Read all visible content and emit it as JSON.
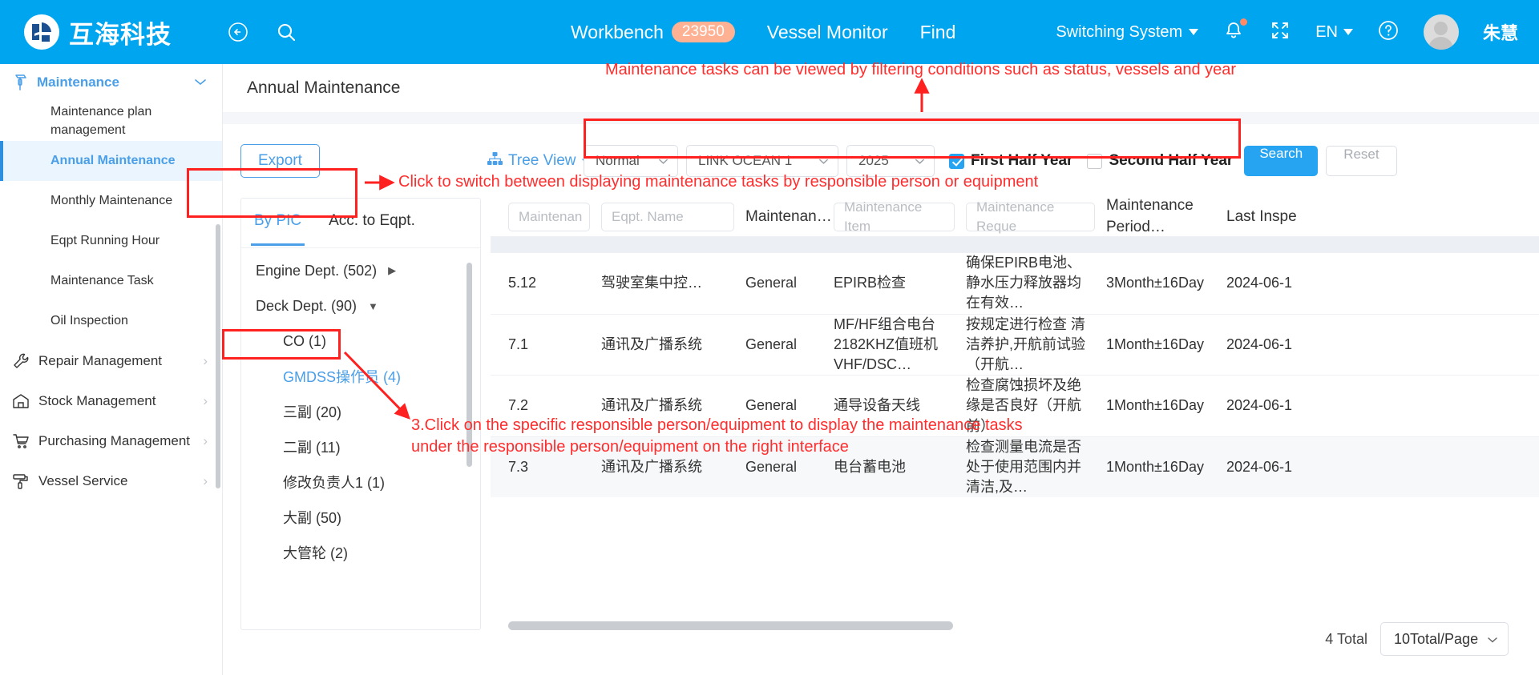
{
  "header": {
    "brand": "互海科技",
    "back_icon": "back-arrow-icon",
    "search_icon": "search-icon",
    "nav": [
      {
        "label": "Workbench",
        "badge": "23950"
      },
      {
        "label": "Vessel Monitor",
        "badge": ""
      },
      {
        "label": "Find",
        "badge": ""
      }
    ],
    "switching_system": "Switching System",
    "language": "EN",
    "username": "朱慧",
    "bell_icon": "bell-icon",
    "fullscreen_icon": "fullscreen-icon",
    "help_icon": "help-circle-icon",
    "accent": "#00a5f0"
  },
  "sidebar": {
    "group": {
      "label": "Maintenance",
      "icon": "hammer-icon"
    },
    "sub_items": [
      {
        "label": "Maintenance plan management",
        "active": false
      },
      {
        "label": "Annual Maintenance",
        "active": true
      },
      {
        "label": "Monthly Maintenance",
        "active": false
      },
      {
        "label": "Eqpt Running Hour",
        "active": false
      },
      {
        "label": "Maintenance Task",
        "active": false
      },
      {
        "label": "Oil Inspection",
        "active": false
      }
    ],
    "items": [
      {
        "label": "Repair Management",
        "icon": "wrench-icon"
      },
      {
        "label": "Stock Management",
        "icon": "warehouse-icon"
      },
      {
        "label": "Purchasing Management",
        "icon": "cart-icon"
      },
      {
        "label": "Vessel Service",
        "icon": "paint-roller-icon"
      }
    ]
  },
  "page": {
    "title": "Annual Maintenance"
  },
  "toolbar": {
    "export_label": "Export",
    "tree_view_label": "Tree View",
    "status_filter": "Normal",
    "vessel_filter": "LINK OCEAN 1",
    "year_filter": "2025",
    "first_half_label": "First Half Year",
    "first_half_checked": true,
    "second_half_label": "Second Half Year",
    "second_half_checked": false,
    "search_label": "Search",
    "reset_label": "Reset"
  },
  "tree": {
    "tabs": [
      {
        "label": "By PIC",
        "active": true
      },
      {
        "label": "Acc. to Eqpt.",
        "active": false
      }
    ],
    "nodes": [
      {
        "label": "Engine Dept. (502)",
        "level": 0,
        "arrow": "▶",
        "selected": false
      },
      {
        "label": "Deck Dept. (90)",
        "level": 0,
        "arrow": "▼",
        "selected": false
      },
      {
        "label": "CO (1)",
        "level": 1,
        "arrow": "",
        "selected": false
      },
      {
        "label": "GMDSS操作员 (4)",
        "level": 1,
        "arrow": "",
        "selected": true
      },
      {
        "label": "三副 (20)",
        "level": 1,
        "arrow": "",
        "selected": false
      },
      {
        "label": "二副 (11)",
        "level": 1,
        "arrow": "",
        "selected": false
      },
      {
        "label": "修改负责人1 (1)",
        "level": 1,
        "arrow": "",
        "selected": false
      },
      {
        "label": "大副 (50)",
        "level": 1,
        "arrow": "",
        "selected": false
      },
      {
        "label": "大管轮 (2)",
        "level": 1,
        "arrow": "",
        "selected": false
      }
    ]
  },
  "table": {
    "headers": [
      {
        "label": "Maintenan",
        "type": "input"
      },
      {
        "label": "Eqpt. Name",
        "type": "input"
      },
      {
        "label": "Maintenan…",
        "type": "plain"
      },
      {
        "label": "Maintenance Item",
        "type": "input"
      },
      {
        "label": "Maintenance Reque",
        "type": "input"
      },
      {
        "label": "Maintenance Period…",
        "type": "plain"
      },
      {
        "label": "Last Inspe",
        "type": "plain"
      }
    ],
    "rows": [
      {
        "no": "5.12",
        "eqpt": "驾驶室集中控…",
        "type": "General",
        "item": "EPIRB检查",
        "request": "确保EPIRB电池、静水压力释放器均在有效…",
        "period": "3Month±16Day",
        "last": "2024-06-1"
      },
      {
        "no": "7.1",
        "eqpt": "通讯及广播系统",
        "type": "General",
        "item": "MF/HF组合电台 2182KHZ值班机 VHF/DSC…",
        "request": "按规定进行检查 清洁养护,开航前试验（开航…",
        "period": "1Month±16Day",
        "last": "2024-06-1"
      },
      {
        "no": "7.2",
        "eqpt": "通讯及广播系统",
        "type": "General",
        "item": "通导设备天线",
        "request": "检查腐蚀损坏及绝缘是否良好（开航前）",
        "period": "1Month±16Day",
        "last": "2024-06-1"
      },
      {
        "no": "7.3",
        "eqpt": "通讯及广播系统",
        "type": "General",
        "item": "电台蓄电池",
        "request": "检查测量电流是否处于使用范围内并清洁,及…",
        "period": "1Month±16Day",
        "last": "2024-06-1"
      }
    ]
  },
  "pagination": {
    "total_label": "4 Total",
    "page_size": "10Total/Page"
  },
  "annotations": {
    "filter_note": "Maintenance tasks can be viewed by filtering conditions such as status, vessels and year",
    "tab_note": "Click to switch between displaying maintenance tasks by responsible person or equipment",
    "node_note": "3.Click on the specific responsible person/equipment to display the maintenance tasks\nunder the responsible person/equipment on the right interface",
    "color": "#ff2d2d"
  }
}
